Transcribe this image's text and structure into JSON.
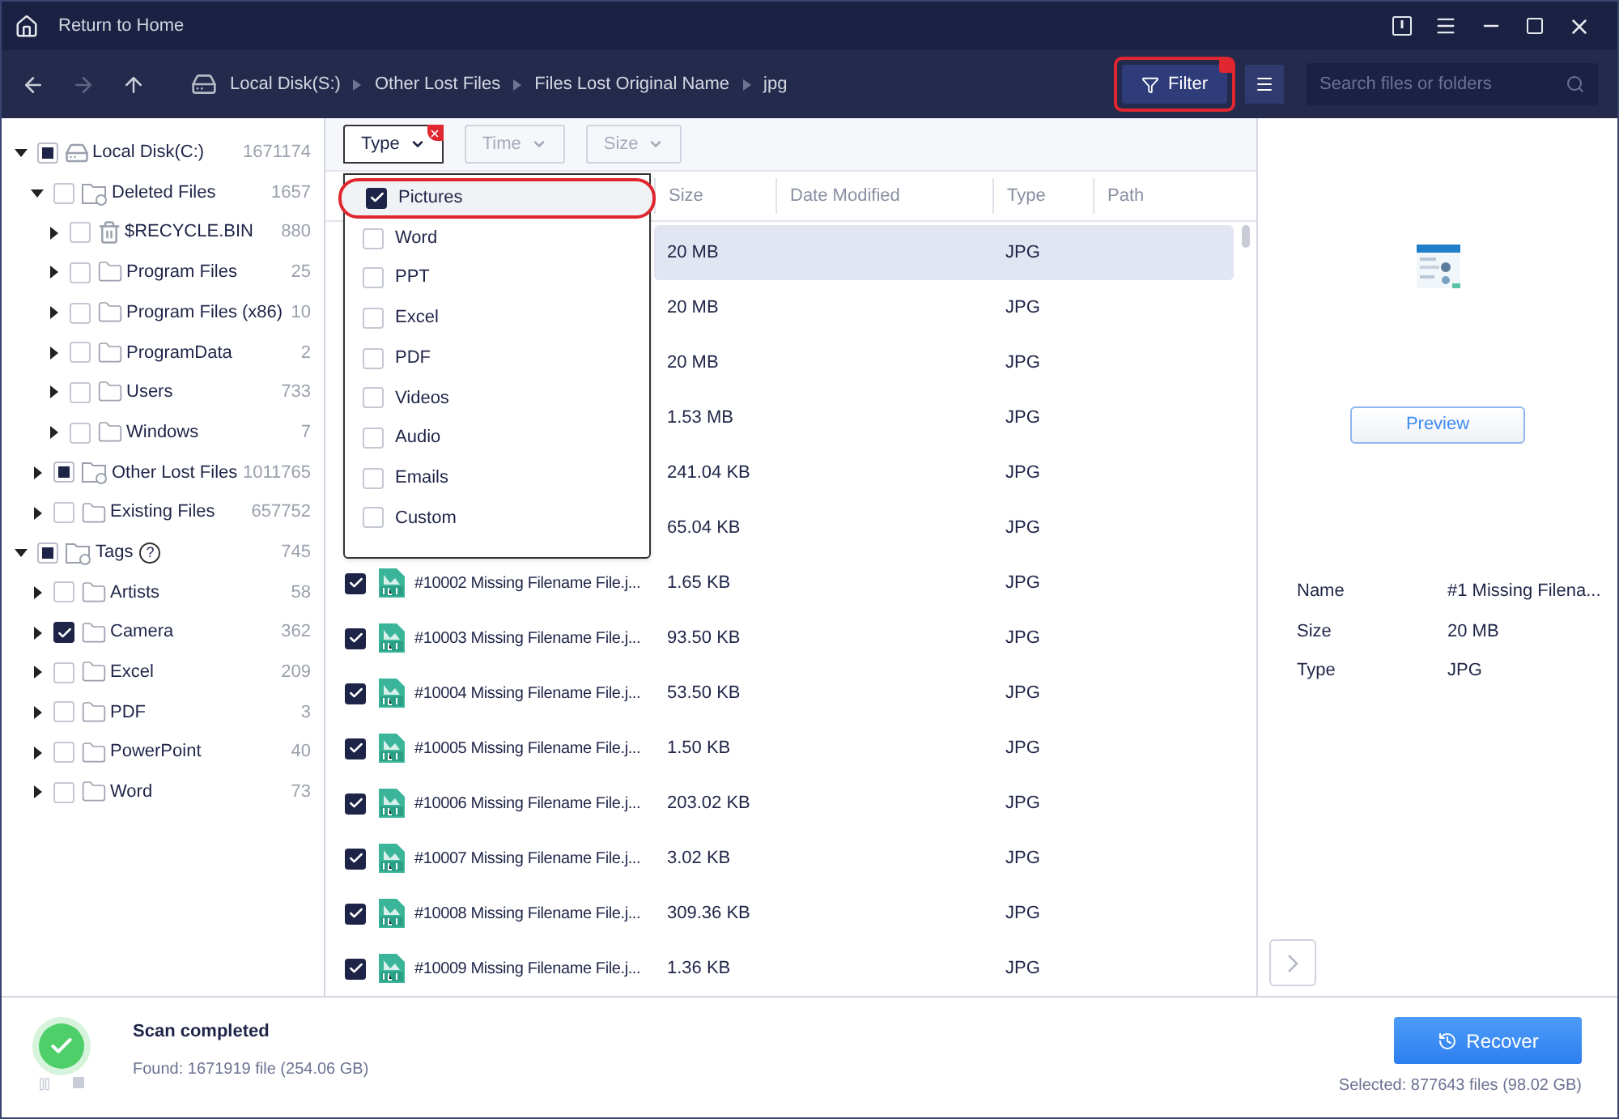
{
  "title_bar": {
    "home_label": "Return to Home"
  },
  "breadcrumb": [
    {
      "label": "Local Disk(S:)",
      "kind": "drive"
    },
    {
      "label": "Other Lost Files",
      "kind": "folder"
    },
    {
      "label": "Files Lost Original Name",
      "kind": "folder"
    },
    {
      "label": "jpg",
      "kind": "folder"
    }
  ],
  "filter_button": {
    "label": "Filter",
    "highlighted": true
  },
  "search": {
    "placeholder": "Search files or folders"
  },
  "tree": [
    {
      "label": "Local Disk(C:)",
      "count": "1671174",
      "kind": "drive",
      "check": true,
      "mixed": true,
      "expanded": true,
      "children": [
        {
          "label": "Deleted Files",
          "count": "1657",
          "kind": "special",
          "check": false,
          "expanded": true,
          "children": [
            {
              "label": "$RECYCLE.BIN",
              "count": "880",
              "kind": "bin",
              "check": false,
              "expanded": false
            },
            {
              "label": "Program Files",
              "count": "25",
              "kind": "folder",
              "check": false,
              "expanded": false
            },
            {
              "label": "Program Files (x86)",
              "count": "10",
              "kind": "folder",
              "check": false,
              "expanded": false
            },
            {
              "label": "ProgramData",
              "count": "2",
              "kind": "folder",
              "check": false,
              "expanded": false
            },
            {
              "label": "Users",
              "count": "733",
              "kind": "folder",
              "check": false,
              "expanded": false
            },
            {
              "label": "Windows",
              "count": "7",
              "kind": "folder",
              "check": false,
              "expanded": false
            }
          ]
        },
        {
          "label": "Other Lost Files",
          "count": "1011765",
          "kind": "special",
          "check": true,
          "mixed": true,
          "expanded": false
        },
        {
          "label": "Existing Files",
          "count": "657752",
          "kind": "folder",
          "check": false,
          "expanded": false
        }
      ]
    },
    {
      "label": "Tags",
      "count": "745",
      "kind": "tags",
      "check": true,
      "mixed": true,
      "expanded": true,
      "help": "?",
      "children": [
        {
          "label": "Artists",
          "count": "58",
          "kind": "folder",
          "check": false,
          "expanded": false
        },
        {
          "label": "Camera",
          "count": "362",
          "kind": "folder",
          "check": true,
          "expanded": false
        },
        {
          "label": "Excel",
          "count": "209",
          "kind": "folder",
          "check": false,
          "expanded": false
        },
        {
          "label": "PDF",
          "count": "3",
          "kind": "folder",
          "check": false,
          "expanded": false
        },
        {
          "label": "PowerPoint",
          "count": "40",
          "kind": "folder",
          "check": false,
          "expanded": false
        },
        {
          "label": "Word",
          "count": "73",
          "kind": "folder",
          "check": false,
          "expanded": false
        }
      ]
    }
  ],
  "filters": [
    {
      "label": "Type",
      "active": true,
      "open": true
    },
    {
      "label": "Time",
      "active": false,
      "open": false
    },
    {
      "label": "Size",
      "active": false,
      "open": false
    }
  ],
  "type_menu": [
    {
      "label": "Pictures",
      "checked": true,
      "highlighted": true
    },
    {
      "label": "Word",
      "checked": false,
      "highlighted": false
    },
    {
      "label": "PPT",
      "checked": false,
      "highlighted": false
    },
    {
      "label": "Excel",
      "checked": false,
      "highlighted": false
    },
    {
      "label": "PDF",
      "checked": false,
      "highlighted": false
    },
    {
      "label": "Videos",
      "checked": false,
      "highlighted": false
    },
    {
      "label": "Audio",
      "checked": false,
      "highlighted": false
    },
    {
      "label": "Emails",
      "checked": false,
      "highlighted": false
    },
    {
      "label": "Custom",
      "checked": false,
      "highlighted": false
    }
  ],
  "table": {
    "columns": [
      "Size",
      "Date Modified",
      "Type",
      "Path"
    ],
    "rows": [
      {
        "size": "20 MB",
        "type": "JPG",
        "selected": true
      },
      {
        "size": "20 MB",
        "type": "JPG",
        "selected": false
      },
      {
        "size": "20 MB",
        "type": "JPG",
        "selected": false
      },
      {
        "size": "1.53 MB",
        "type": "JPG",
        "selected": false
      },
      {
        "size": "241.04 KB",
        "type": "JPG",
        "selected": false
      },
      {
        "size": "65.04 KB",
        "type": "JPG",
        "selected": false
      },
      {
        "name": "#10002 Missing Filename File.j...",
        "checked": true,
        "size": "1.65 KB",
        "type": "JPG",
        "selected": false
      },
      {
        "name": "#10003 Missing Filename File.j...",
        "checked": true,
        "size": "93.50 KB",
        "type": "JPG",
        "selected": false
      },
      {
        "name": "#10004 Missing Filename File.j...",
        "checked": true,
        "size": "53.50 KB",
        "type": "JPG",
        "selected": false
      },
      {
        "name": "#10005 Missing Filename File.j...",
        "checked": true,
        "size": "1.50 KB",
        "type": "JPG",
        "selected": false
      },
      {
        "name": "#10006 Missing Filename File.j...",
        "checked": true,
        "size": "203.02 KB",
        "type": "JPG",
        "selected": false
      },
      {
        "name": "#10007 Missing Filename File.j...",
        "checked": true,
        "size": "3.02 KB",
        "type": "JPG",
        "selected": false
      },
      {
        "name": "#10008 Missing Filename File.j...",
        "checked": true,
        "size": "309.36 KB",
        "type": "JPG",
        "selected": false
      },
      {
        "name": "#10009 Missing Filename File.j...",
        "checked": true,
        "size": "1.36 KB",
        "type": "JPG",
        "selected": false
      }
    ]
  },
  "preview": {
    "button": "Preview",
    "details": [
      {
        "label": "Name",
        "value": "#1 Missing Filena..."
      },
      {
        "label": "Size",
        "value": "20 MB"
      },
      {
        "label": "Type",
        "value": "JPG"
      }
    ]
  },
  "status": {
    "title": "Scan completed",
    "found": "Found: 1671919 file (254.06 GB)",
    "recover": "Recover",
    "selected": "Selected: 877643 files (98.02 GB)"
  }
}
